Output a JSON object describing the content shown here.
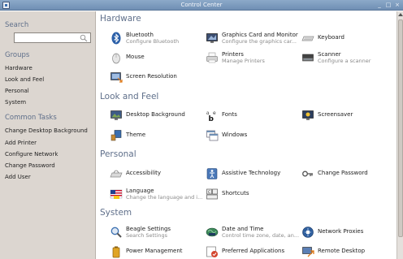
{
  "window": {
    "title": "Control Center",
    "controls": [
      "_",
      "□",
      "×"
    ]
  },
  "sidebar": {
    "search_heading": "Search",
    "search_value": "",
    "groups_heading": "Groups",
    "groups": [
      "Hardware",
      "Look and Feel",
      "Personal",
      "System"
    ],
    "tasks_heading": "Common Tasks",
    "tasks": [
      "Change Desktop Background",
      "Add Printer",
      "Configure Network",
      "Change Password",
      "Add User"
    ]
  },
  "sections": {
    "hardware": {
      "title": "Hardware",
      "items": [
        {
          "title": "Bluetooth",
          "subtitle": "Configure Bluetooth",
          "icon": "bluetooth-icon"
        },
        {
          "title": "Graphics Card and Monitor",
          "subtitle": "Configure the graphics car...",
          "icon": "monitor-icon"
        },
        {
          "title": "Keyboard",
          "subtitle": "",
          "icon": "keyboard-icon"
        },
        {
          "title": "Mouse",
          "subtitle": "",
          "icon": "mouse-icon"
        },
        {
          "title": "Printers",
          "subtitle": "Manage Printers",
          "icon": "printer-icon"
        },
        {
          "title": "Scanner",
          "subtitle": "Configure a scanner",
          "icon": "scanner-icon"
        },
        {
          "title": "Screen Resolution",
          "subtitle": "",
          "icon": "screen-resolution-icon"
        }
      ]
    },
    "look_and_feel": {
      "title": "Look and Feel",
      "items": [
        {
          "title": "Desktop Background",
          "subtitle": "",
          "icon": "desktop-background-icon"
        },
        {
          "title": "Fonts",
          "subtitle": "",
          "icon": "fonts-icon"
        },
        {
          "title": "Screensaver",
          "subtitle": "",
          "icon": "screensaver-icon"
        },
        {
          "title": "Theme",
          "subtitle": "",
          "icon": "theme-icon"
        },
        {
          "title": "Windows",
          "subtitle": "",
          "icon": "windows-icon"
        }
      ]
    },
    "personal": {
      "title": "Personal",
      "items": [
        {
          "title": "Accessibility",
          "subtitle": "",
          "icon": "accessibility-icon"
        },
        {
          "title": "Assistive Technology",
          "subtitle": "",
          "icon": "assistive-technology-icon"
        },
        {
          "title": "Change Password",
          "subtitle": "",
          "icon": "password-key-icon"
        },
        {
          "title": "Language",
          "subtitle": "Change the language and i...",
          "icon": "language-flag-icon"
        },
        {
          "title": "Shortcuts",
          "subtitle": "",
          "icon": "shortcuts-icon"
        }
      ]
    },
    "system": {
      "title": "System",
      "items": [
        {
          "title": "Beagle Settings",
          "subtitle": "Search Settings",
          "icon": "beagle-search-icon"
        },
        {
          "title": "Date and Time",
          "subtitle": "Control time zone, date, an...",
          "icon": "date-time-icon"
        },
        {
          "title": "Network Proxies",
          "subtitle": "",
          "icon": "network-proxies-icon"
        },
        {
          "title": "Power Management",
          "subtitle": "",
          "icon": "power-management-icon"
        },
        {
          "title": "Preferred Applications",
          "subtitle": "",
          "icon": "preferred-applications-icon"
        },
        {
          "title": "Remote Desktop",
          "subtitle": "",
          "icon": "remote-desktop-icon"
        }
      ]
    }
  }
}
